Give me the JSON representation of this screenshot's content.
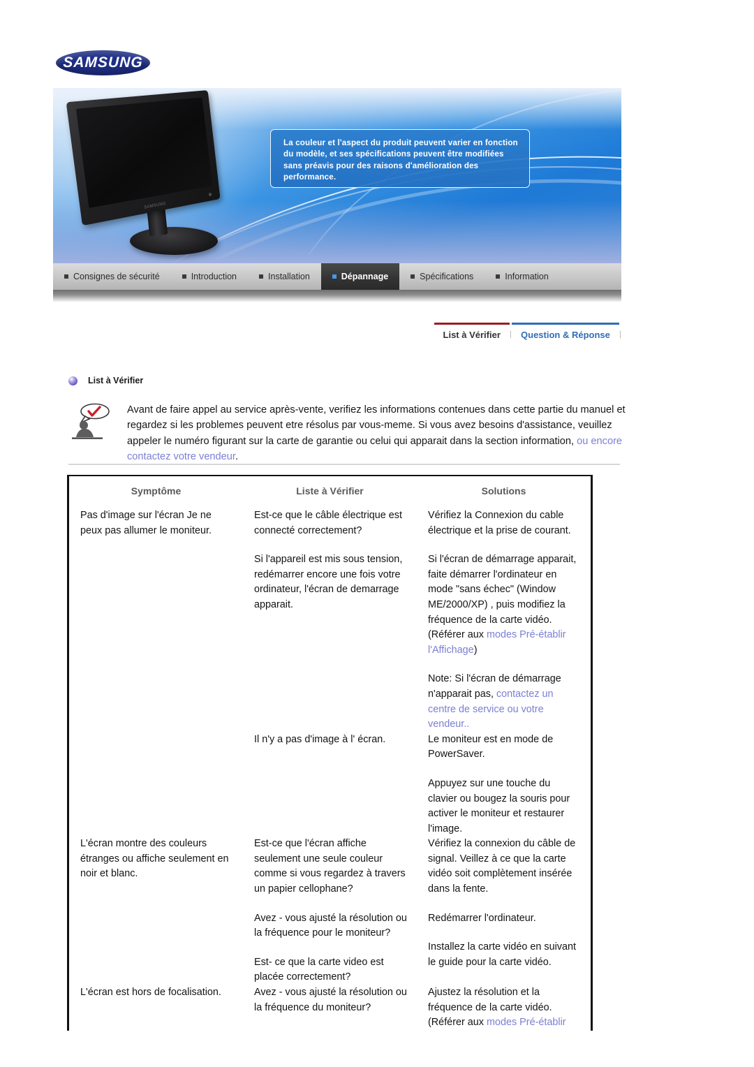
{
  "brand": {
    "logo_text": "SAMSUNG"
  },
  "hero": {
    "callout": "La couleur et l'aspect du produit peuvent varier en fonction du modèle, et ses spécifications peuvent être modifiées sans préavis pour des raisons d'amélioration des performance.",
    "monitor_brand_mark": "SAMSUNG"
  },
  "nav": {
    "items": [
      {
        "label": "Consignes de sécurité",
        "active": false
      },
      {
        "label": "Introduction",
        "active": false
      },
      {
        "label": "Installation",
        "active": false
      },
      {
        "label": "Dépannage",
        "active": true
      },
      {
        "label": "Spécifications",
        "active": false
      },
      {
        "label": "Information",
        "active": false
      }
    ]
  },
  "subnav": {
    "tabs": [
      {
        "label": "List à Vérifier",
        "active": true
      },
      {
        "label": "Question & Réponse",
        "active": false
      }
    ],
    "separator": "|"
  },
  "section": {
    "heading": "List à Vérifier",
    "intro_part1": "Avant de faire appel au service après-vente, verifiez les informations contenues dans cette partie du manuel et regardez si les problemes peuvent etre résolus par vous-meme. Si vous avez besoins d'assistance, veuillez appeler le numéro figurant sur la carte de garantie ou celui qui apparait dans la section information, ",
    "intro_link": "ou encore contactez votre vendeur",
    "intro_part2": "."
  },
  "table": {
    "headers": [
      "Symptôme",
      "Liste à Vérifier",
      "Solutions"
    ],
    "rows": [
      {
        "symptom": "Pas d'image sur l'écran Je ne peux pas allumer le moniteur.",
        "checks": [
          "Est-ce que le câble électrique est connecté correctement?",
          "Si l'appareil est mis sous tension, redémarrer encore une fois votre ordinateur, l'écran de demarrage apparait."
        ],
        "solutions": [
          {
            "text": "Vérifiez la Connexion du cable électrique et la prise de courant."
          },
          {
            "text": "Si l'écran de démarrage apparait, faite démarrer l'ordinateur en mode \"sans échec\" (Window ME/2000/XP) , puis modifiez la fréquence de la carte vidéo. (Référer aux ",
            "link": "modes Pré-établir l'Affichage",
            "tail": ")"
          },
          {
            "text": "Note: Si l'écran de démarrage n'apparait pas, ",
            "link": "contactez un centre de service ou votre vendeur",
            "tail": ".."
          }
        ]
      },
      {
        "symptom": "",
        "checks": [
          "Il n'y a pas d'image à l' écran."
        ],
        "solutions": [
          {
            "text": "Le moniteur est en mode de PowerSaver."
          },
          {
            "text": "Appuyez sur une touche du clavier ou bougez la souris pour activer le moniteur et restaurer l'image."
          }
        ]
      },
      {
        "symptom": "L'écran montre des couleurs étranges ou affiche seulement en noir et blanc.",
        "checks": [
          "Est-ce que l'écran affiche seulement une seule couleur comme si vous regardez à travers un papier cellophane?",
          "Avez - vous ajusté la résolution ou la fréquence pour le moniteur?",
          "Est- ce que la carte video est placée correctement?"
        ],
        "solutions": [
          {
            "text": "Vérifiez la connexion du câble de signal. Veillez à ce que la carte vidéo soit complètement insérée dans la fente."
          },
          {
            "text": "Redémarrer l'ordinateur."
          },
          {
            "text": "Installez la carte vidéo en suivant le guide pour la carte vidéo."
          }
        ]
      },
      {
        "symptom": "L'écran est hors de focalisation.",
        "checks": [
          "Avez - vous ajusté la résolution ou la fréquence du moniteur?"
        ],
        "solutions": [
          {
            "text": "Ajustez la résolution et la fréquence de la carte vidéo. (Référer aux ",
            "link": "modes Pré-établir",
            "tail": ""
          }
        ]
      }
    ]
  },
  "colors": {
    "link": "#7b7fd4",
    "accent_red": "#9b1c23",
    "accent_blue": "#2f6fb5",
    "samsung_blue": "#1f2f86",
    "active_tab_bullet": "#3f9bee"
  }
}
